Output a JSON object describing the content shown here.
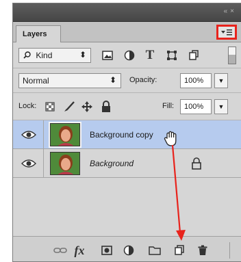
{
  "panel": {
    "tab_label": "Layers",
    "menu_button_icon": "panel-menu-icon",
    "collapse_icon": "collapse-arrows-icon",
    "close_icon": "close-icon"
  },
  "filter": {
    "kind_label": "Kind",
    "icons": [
      "pixel-layer-filter-icon",
      "adjustment-filter-icon",
      "type-filter-icon",
      "shape-filter-icon",
      "smart-object-filter-icon"
    ]
  },
  "blending": {
    "mode": "Normal",
    "opacity_label": "Opacity:",
    "opacity_value": "100%"
  },
  "locks": {
    "label": "Lock:",
    "fill_label": "Fill:",
    "fill_value": "100%"
  },
  "layers": [
    {
      "name": "Background copy",
      "selected": true
    },
    {
      "name": "Background",
      "selected": false,
      "locked": true
    }
  ],
  "bottom_bar": {
    "fx_label": "fx"
  },
  "colors": {
    "highlight": "#e8231c",
    "selected_row": "#b6cbee",
    "panel_bg": "#d6d6d6"
  }
}
